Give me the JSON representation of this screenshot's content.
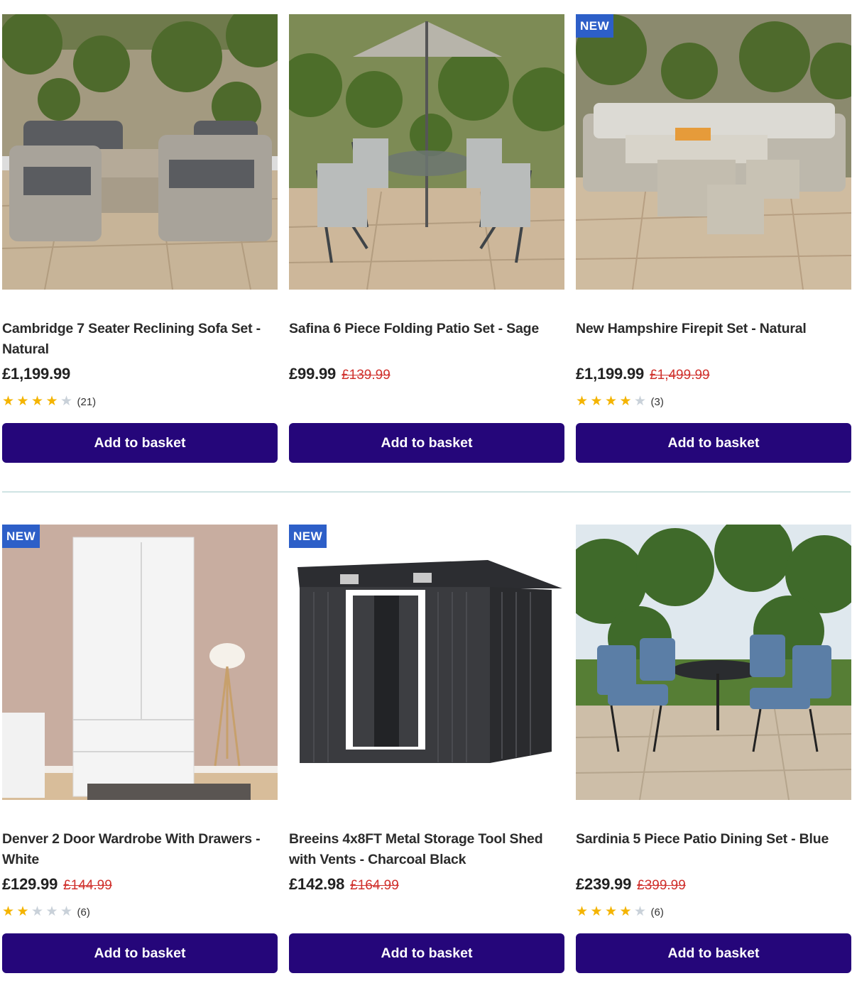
{
  "products": [
    {
      "name": "Cambridge 7 Seater Reclining Sofa Set - Natural",
      "price": "£1,199.99",
      "was_price": "",
      "badge": "",
      "rating": 4,
      "reviews": "(21)",
      "button": "Add to basket",
      "image": "rattan-sofa-set-photo"
    },
    {
      "name": "Safina 6 Piece Folding Patio Set - Sage",
      "price": "£99.99",
      "was_price": "£139.99",
      "badge": "",
      "rating": 0,
      "reviews": "",
      "button": "Add to basket",
      "image": "folding-patio-set-photo"
    },
    {
      "name": "New Hampshire Firepit Set - Natural",
      "price": "£1,199.99",
      "was_price": "£1,499.99",
      "badge": "NEW",
      "rating": 4,
      "reviews": "(3)",
      "button": "Add to basket",
      "image": "firepit-set-photo"
    },
    {
      "name": "Denver 2 Door Wardrobe With Drawers - White",
      "price": "£129.99",
      "was_price": "£144.99",
      "badge": "NEW",
      "rating": 2,
      "reviews": "(6)",
      "button": "Add to basket",
      "image": "white-wardrobe-photo"
    },
    {
      "name": "Breeins 4x8FT Metal Storage Tool Shed with Vents - Charcoal Black",
      "price": "£142.98",
      "was_price": "£164.99",
      "badge": "NEW",
      "rating": 0,
      "reviews": "",
      "button": "Add to basket",
      "image": "metal-shed-photo"
    },
    {
      "name": "Sardinia 5 Piece Patio Dining Set - Blue",
      "price": "£239.99",
      "was_price": "£399.99",
      "badge": "",
      "rating": 4,
      "reviews": "(6)",
      "button": "Add to basket",
      "image": "blue-dining-set-photo"
    }
  ],
  "colors": {
    "button_bg": "#25067a",
    "badge_bg": "#2d5fc8",
    "was_price": "#d0312d",
    "star_on": "#f4b400",
    "star_off": "#c9d1d9"
  }
}
